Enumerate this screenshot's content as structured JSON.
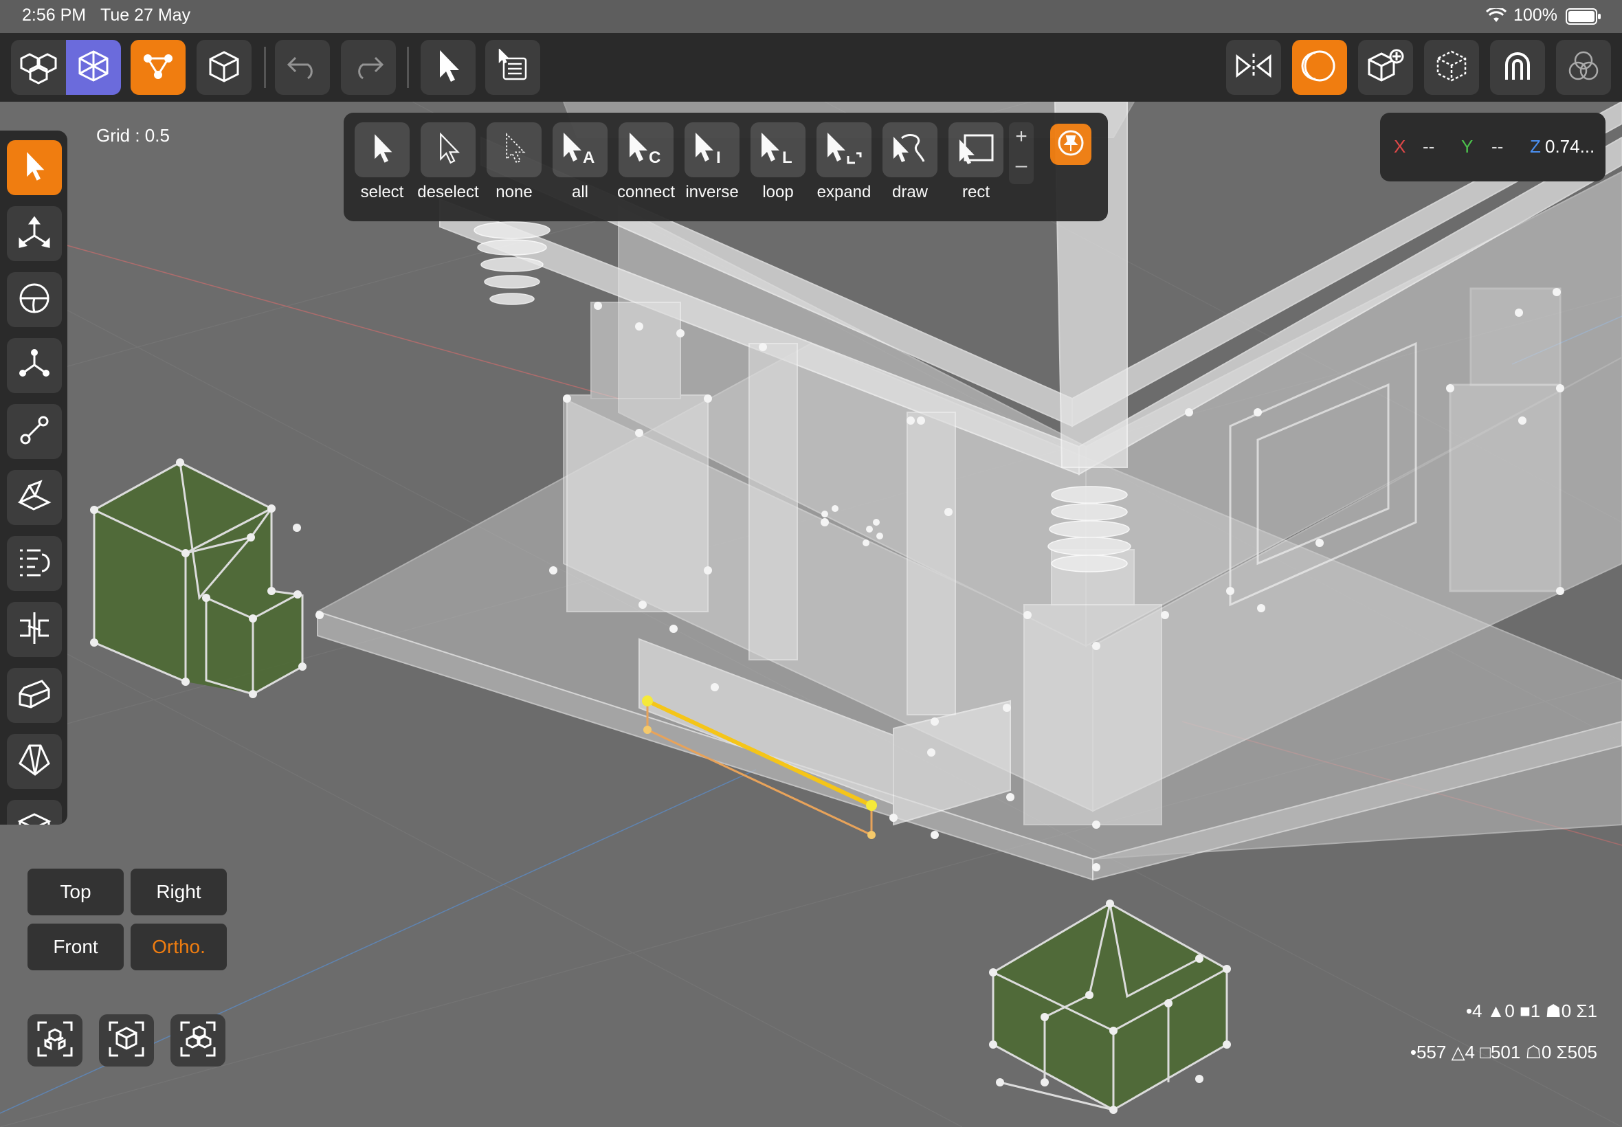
{
  "status_bar": {
    "time": "2:56 PM",
    "date": "Tue 27 May",
    "battery": "100%",
    "wifi_icon": "wifi-icon",
    "battery_icon": "battery-icon"
  },
  "toolbar": {
    "left_icons": [
      "object-mode-icon",
      "edit-mesh-icon",
      "vertex-mode-icon",
      "object-cube-icon",
      "undo-icon",
      "redo-icon",
      "select-pointer-icon",
      "selection-list-icon"
    ],
    "right_icons": [
      "mirror-icon",
      "xray-icon",
      "add-primitive-icon",
      "wireframe-cube-icon",
      "magnet-snap-icon",
      "boolean-icon"
    ]
  },
  "viewport": {
    "grid_label": "Grid : 0.5"
  },
  "selection_bar": {
    "tools": [
      {
        "label": "select",
        "icon": "arrow-filled-icon"
      },
      {
        "label": "deselect",
        "icon": "arrow-outline-icon"
      },
      {
        "label": "none",
        "icon": "arrow-dotted-icon"
      },
      {
        "label": "all",
        "icon": "arrow-a-icon"
      },
      {
        "label": "connect",
        "icon": "arrow-c-icon"
      },
      {
        "label": "inverse",
        "icon": "arrow-i-icon"
      },
      {
        "label": "loop",
        "icon": "arrow-l-icon"
      },
      {
        "label": "expand",
        "icon": "arrow-expand-icon"
      },
      {
        "label": "draw",
        "icon": "arrow-draw-icon"
      },
      {
        "label": "rect",
        "icon": "arrow-rect-icon"
      }
    ],
    "zoom_plus": "+",
    "zoom_minus": "–",
    "pin_icon": "pin-icon"
  },
  "coordinates": {
    "x_label": "X",
    "x_value": "--",
    "y_label": "Y",
    "y_value": "--",
    "z_label": "Z",
    "z_value": "0.74..."
  },
  "left_tools": [
    "select-tool-icon",
    "move-tool-icon",
    "rotate-tool-icon",
    "scale-tool-icon",
    "connect-vertices-icon",
    "extrude-face-icon",
    "list-edit-icon",
    "split-tool-icon",
    "bevel-tool-icon",
    "cube-tool-icon",
    "plane-tool-icon"
  ],
  "view_buttons": {
    "top": "Top",
    "right": "Right",
    "front": "Front",
    "ortho": "Ortho."
  },
  "frame_buttons": [
    "frame-all-icon",
    "frame-selected-icon",
    "frame-object-icon"
  ],
  "stats": {
    "selected": "•4 ▲0 ■1 ☗0 Σ1",
    "total": "•557 △4 □501 ☖0 Σ505"
  },
  "colors": {
    "accent": "#f07d10",
    "edit_mode": "#6b6bdc",
    "selection": "#f5c518",
    "green_object": "#4e6a34"
  }
}
